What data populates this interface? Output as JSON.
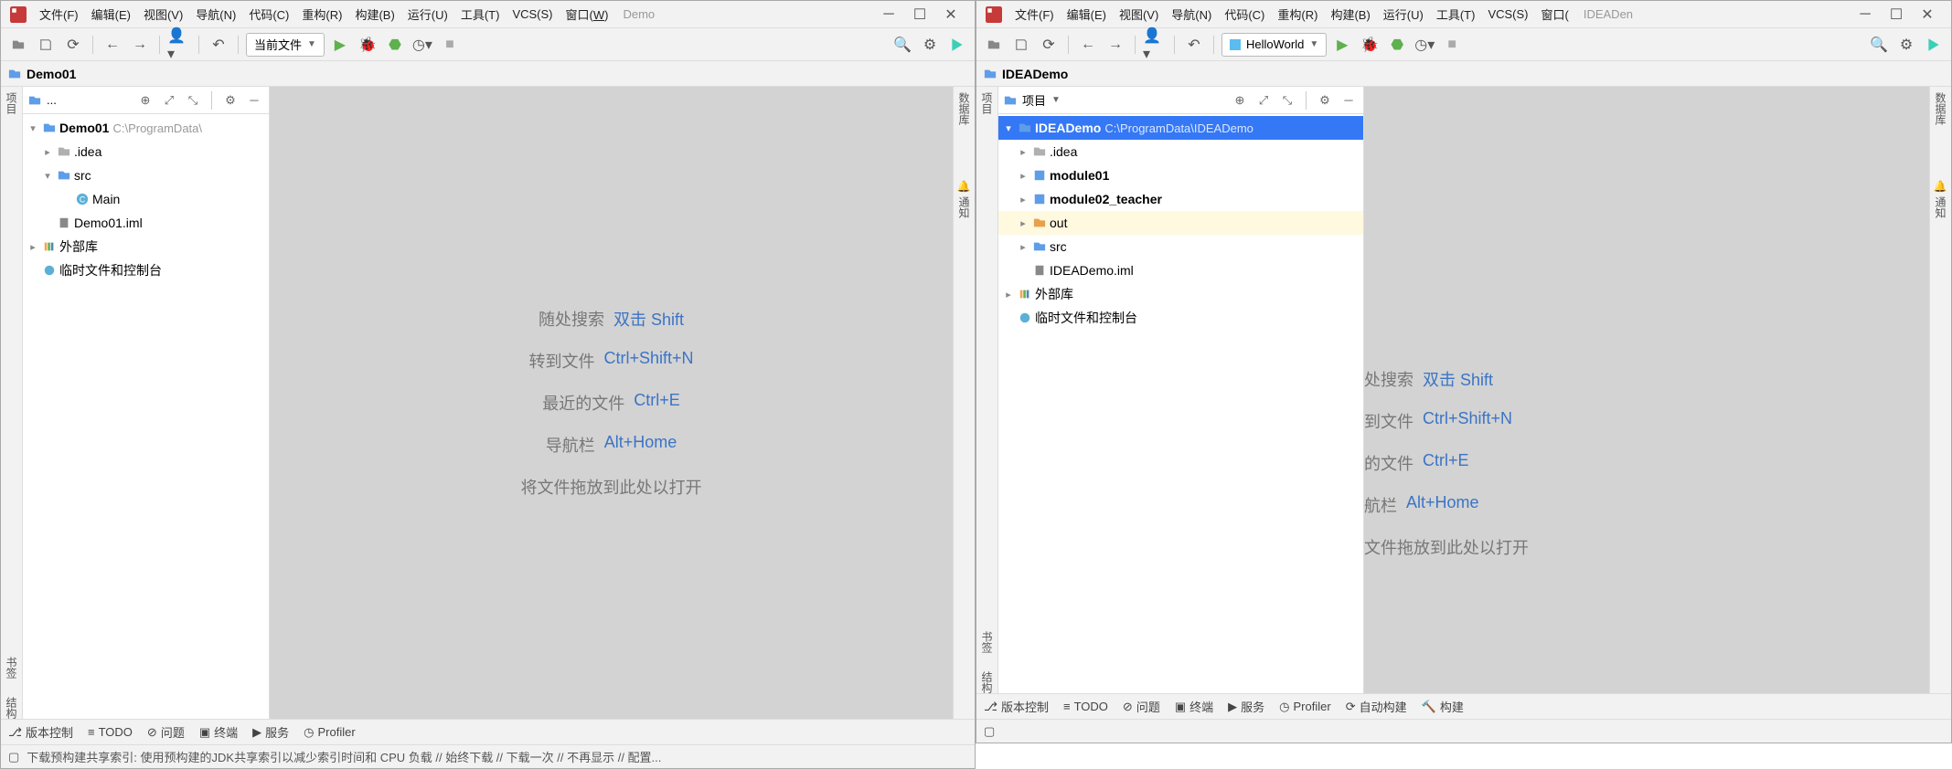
{
  "menu": {
    "file": "文件(F)",
    "edit": "编辑(E)",
    "view": "视图(V)",
    "nav": "导航(N)",
    "code": "代码(C)",
    "refactor": "重构(R)",
    "build": "构建(B)",
    "run": "运行(U)",
    "tools": "工具(T)",
    "vcs": "VCS(S)",
    "window": "窗口("
  },
  "left": {
    "title": "Demo",
    "run_config": "当前文件",
    "breadcrumb": "Demo01",
    "panel_label": "...",
    "tree": {
      "root": "Demo01",
      "root_path": "C:\\ProgramData\\",
      "idea": ".idea",
      "src": "src",
      "main": "Main",
      "iml": "Demo01.iml",
      "ext": "外部库",
      "scratch": "临时文件和控制台"
    },
    "status": "下载预构建共享索引: 使用预构建的JDK共享索引以减少索引时间和 CPU 负载 // 始终下载 // 下载一次 // 不再显示 // 配置..."
  },
  "right": {
    "title": "IDEADen",
    "run_config": "HelloWorld",
    "breadcrumb": "IDEADemo",
    "panel_label": "项目",
    "tree": {
      "root": "IDEADemo",
      "root_path": "C:\\ProgramData\\IDEADemo",
      "idea": ".idea",
      "mod1": "module01",
      "mod2": "module02_teacher",
      "out": "out",
      "src": "src",
      "iml": "IDEADemo.iml",
      "ext": "外部库",
      "scratch": "临时文件和控制台"
    }
  },
  "hints": {
    "search": "随处搜索",
    "search_key": "双击 Shift",
    "goto": "转到文件",
    "goto_key": "Ctrl+Shift+N",
    "recent": "最近的文件",
    "recent_key": "Ctrl+E",
    "navbar": "导航栏",
    "navbar_key": "Alt+Home",
    "drop": "将文件拖放到此处以打开",
    "partial_search": "处搜索",
    "partial_goto": "到文件",
    "partial_recent": "的文件",
    "partial_navbar": "航栏",
    "partial_drop": "文件拖放到此处以打开"
  },
  "side": {
    "project": "项目",
    "bookmark": "书签",
    "structure": "结构",
    "database": "数据库",
    "notify": "通知"
  },
  "bottom": {
    "vcs": "版本控制",
    "todo": "TODO",
    "problems": "问题",
    "terminal": "终端",
    "services": "服务",
    "profiler": "Profiler",
    "autobuild": "自动构建",
    "build": "构建"
  }
}
